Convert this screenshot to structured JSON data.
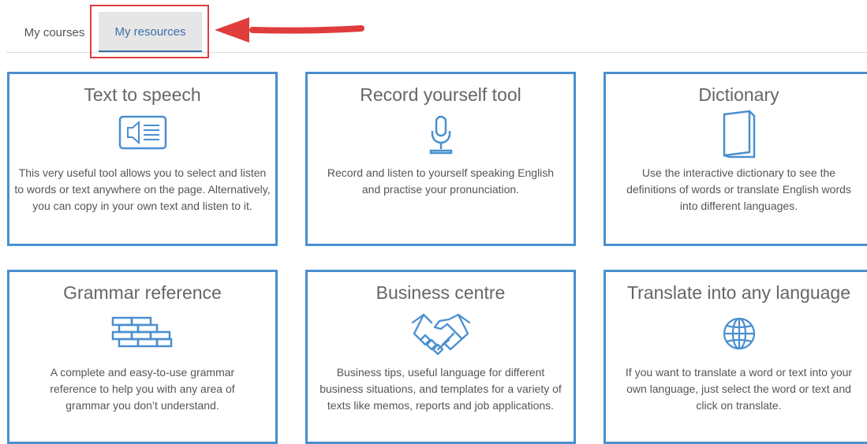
{
  "tabs": [
    {
      "label": "My courses"
    },
    {
      "label": "My resources"
    }
  ],
  "cards": [
    {
      "title": "Text to speech",
      "icon": "speaker-text-icon",
      "description": "This very useful tool allows you to select and listen to words or text anywhere on the page. Alternatively, you can copy in your own text and listen to it."
    },
    {
      "title": "Record yourself tool",
      "icon": "microphone-icon",
      "description": "Record and listen to yourself speaking English and practise your pronunciation."
    },
    {
      "title": "Dictionary",
      "icon": "book-icon",
      "description": "Use the interactive dictionary to see the definitions of words or translate English words into different languages."
    },
    {
      "title": "Grammar reference",
      "icon": "brick-wall-icon",
      "description": "A complete and easy-to-use grammar reference to help you with any area of grammar you don’t understand."
    },
    {
      "title": "Business centre",
      "icon": "handshake-icon",
      "description": "Business tips, useful language for different business situations, and templates for a variety of texts like memos, reports and job applications."
    },
    {
      "title": "Translate into any language",
      "icon": "globe-icon",
      "description": "If you want to translate a word or text into your own language, just select the word or text and click on translate."
    }
  ],
  "colors": {
    "accent": "#4a8fcf",
    "highlight": "#e03c3c",
    "tab_active_text": "#3a6fa9"
  }
}
